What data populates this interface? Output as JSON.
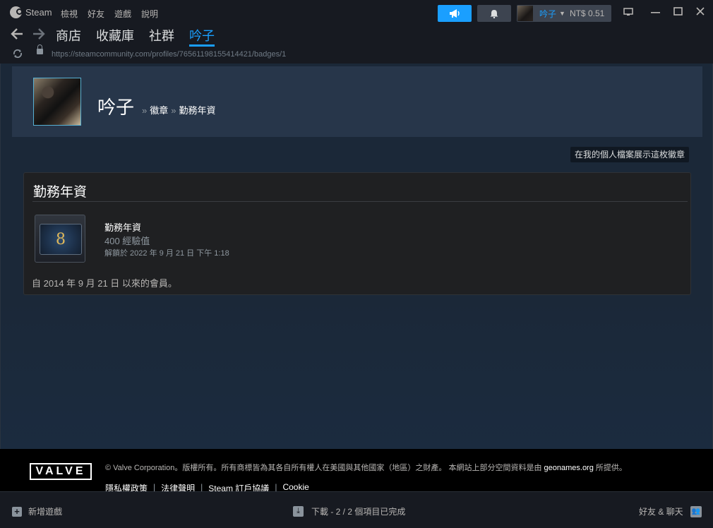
{
  "titlebar": {
    "app_name": "Steam",
    "menu": [
      "檢視",
      "好友",
      "遊戲",
      "說明"
    ],
    "account_name": "吟子",
    "wallet": "NT$ 0.51",
    "icons": {
      "announce": "megaphone-icon",
      "bell": "bell-icon",
      "monitor": "monitor-icon",
      "minimize": "minimize-icon",
      "maximize": "maximize-icon",
      "close": "close-icon"
    }
  },
  "nav": {
    "tabs": [
      "商店",
      "收藏庫",
      "社群",
      "吟子"
    ],
    "active_tab": "吟子"
  },
  "url": "https://steamcommunity.com/profiles/76561198155414421/badges/1",
  "profile": {
    "name": "吟子",
    "breadcrumb": [
      "徽章",
      "勤務年資"
    ]
  },
  "showcase_button": "在我的個人檔案展示這枚徽章",
  "badge": {
    "panel_title": "勤務年資",
    "icon_text": "8",
    "name": "勤務年資",
    "xp": "400 經驗值",
    "unlocked": "解鎖於 2022 年 9 月 21 日 下午 1:18",
    "member_since": "自 2014 年 9 月 21 日 以來的會員。"
  },
  "footer": {
    "logo": "VALVE",
    "copyright_pre": "© Valve Corporation。版權所有。所有商標皆為其各自所有權人在美國與其他國家（地區）之財產。 本網站上部分空間資料是由",
    "copyright_link": "geonames.org",
    "copyright_post": "所提供。",
    "links": [
      "隱私權政策",
      "法律聲明",
      "Steam 訂戶協議",
      "Cookie"
    ]
  },
  "statusbar": {
    "add_game": "新增遊戲",
    "downloads": "下載 - 2 / 2 個項目已完成",
    "friends": "好友 & 聊天"
  },
  "colors": {
    "accent": "#1a9fff",
    "background": "#1b2838",
    "header_panel": "#27364a"
  }
}
